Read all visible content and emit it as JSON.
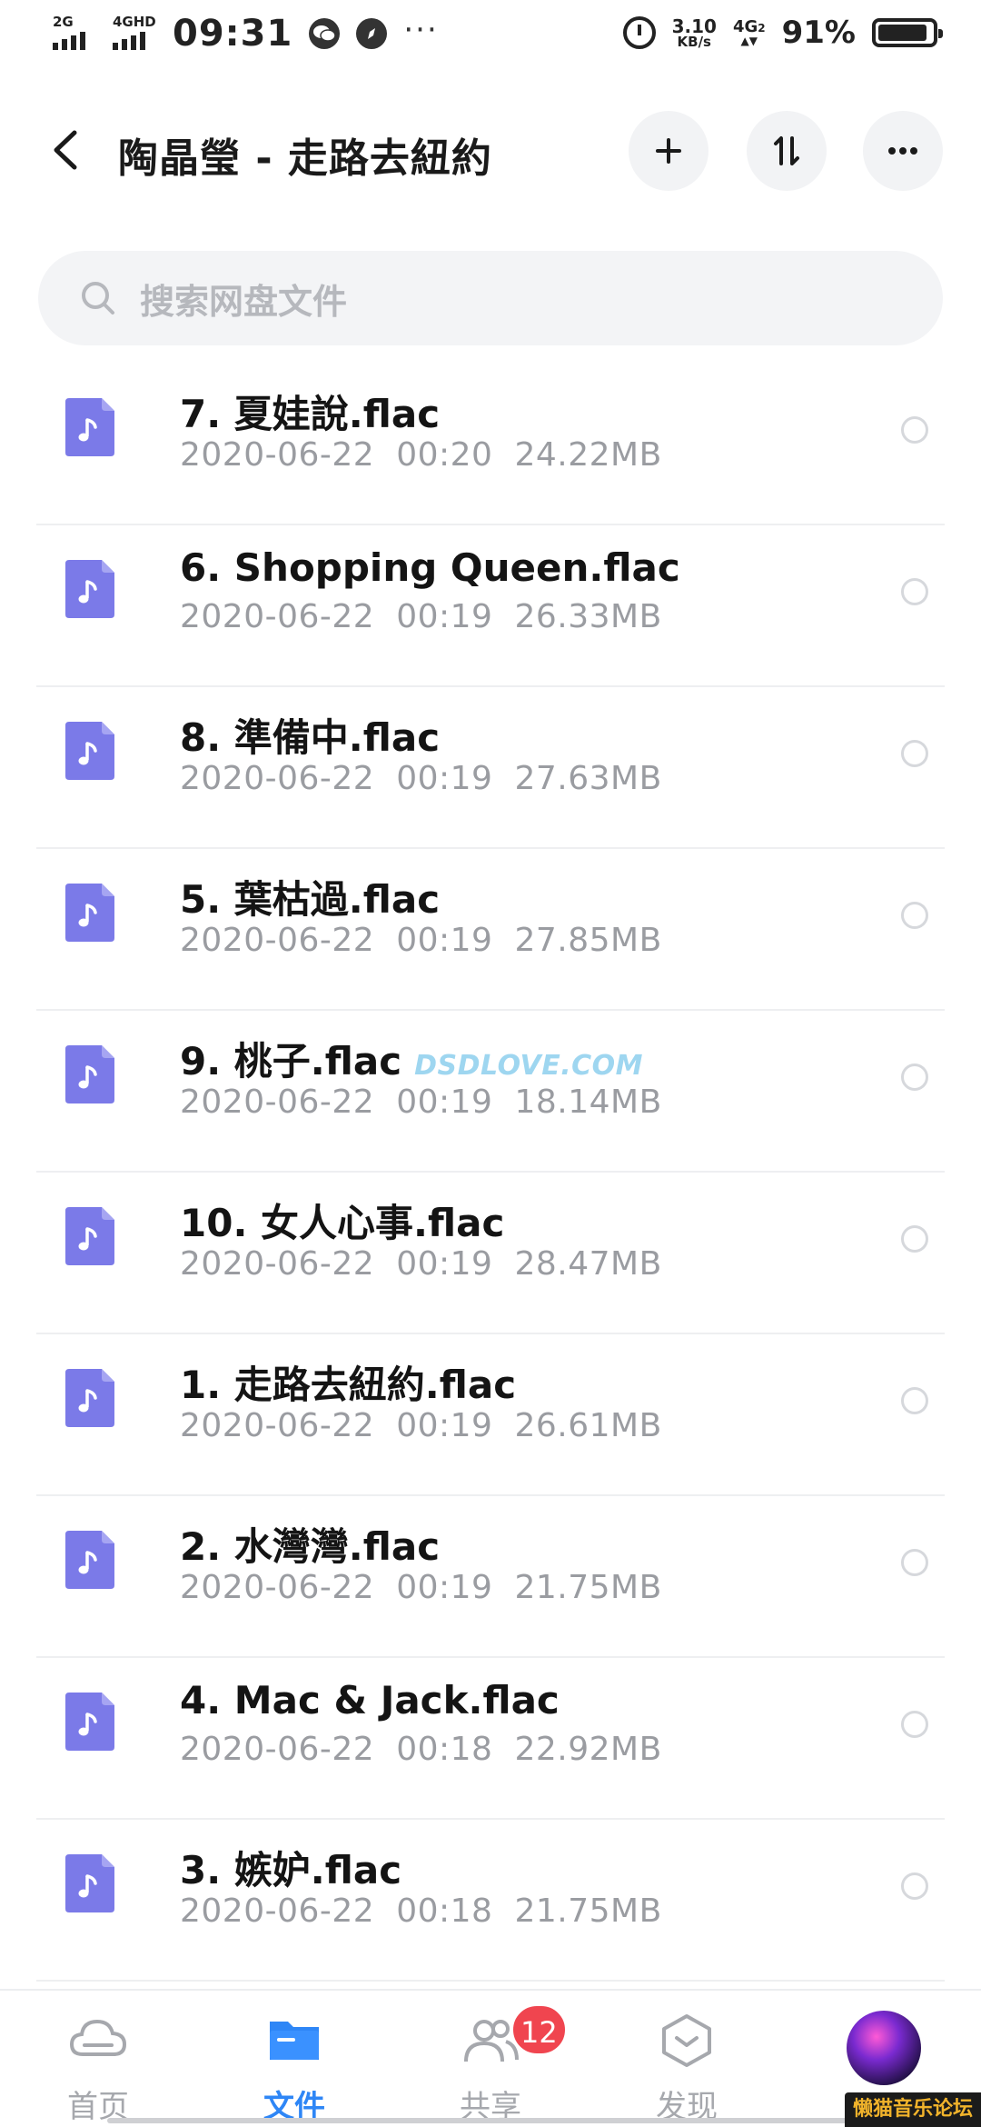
{
  "status_bar": {
    "sim1_label": "2G",
    "sim2_label": "4GHD",
    "time": "09:31",
    "net_speed_value": "3.10",
    "net_speed_unit": "KB/s",
    "net_type": "4G",
    "net_type_sub": "2",
    "battery_percent": "91%",
    "battery_level": 0.91
  },
  "header": {
    "title": "陶晶瑩 - 走路去紐約",
    "icons": [
      "back-icon",
      "add-icon",
      "sort-icon",
      "more-icon"
    ]
  },
  "search": {
    "placeholder": "搜索网盘文件"
  },
  "files": [
    {
      "name": "7. 夏娃說.flac",
      "date": "2020-06-22",
      "time": "00:20",
      "size": "24.22MB"
    },
    {
      "name": "6. Shopping Queen.flac",
      "date": "2020-06-22",
      "time": "00:19",
      "size": "26.33MB"
    },
    {
      "name": "8. 準備中.flac",
      "date": "2020-06-22",
      "time": "00:19",
      "size": "27.63MB"
    },
    {
      "name": "5. 葉枯過.flac",
      "date": "2020-06-22",
      "time": "00:19",
      "size": "27.85MB"
    },
    {
      "name": "9. 桃子.flac",
      "date": "2020-06-22",
      "time": "00:19",
      "size": "18.14MB"
    },
    {
      "name": "10. 女人心事.flac",
      "date": "2020-06-22",
      "time": "00:19",
      "size": "28.47MB"
    },
    {
      "name": "1. 走路去紐約.flac",
      "date": "2020-06-22",
      "time": "00:19",
      "size": "26.61MB"
    },
    {
      "name": "2. 水灣灣.flac",
      "date": "2020-06-22",
      "time": "00:19",
      "size": "21.75MB"
    },
    {
      "name": "4. Mac & Jack.flac",
      "date": "2020-06-22",
      "time": "00:18",
      "size": "22.92MB"
    },
    {
      "name": "3. 嫉妒.flac",
      "date": "2020-06-22",
      "time": "00:18",
      "size": "21.75MB"
    }
  ],
  "watermark": "DSDLOVE.COM",
  "bottom_nav": {
    "items": [
      {
        "label": "首页",
        "icon": "cloud-icon"
      },
      {
        "label": "文件",
        "icon": "folder-icon"
      },
      {
        "label": "共享",
        "icon": "share-people-icon"
      },
      {
        "label": "发现",
        "icon": "discover-icon"
      }
    ],
    "share_badge": "12"
  },
  "forum_label": "懒猫音乐论坛",
  "colors": {
    "accent": "#2e86f6",
    "file_icon": "#7b7ae8",
    "badge": "#f0454f",
    "meta_text": "#9a9ca1"
  }
}
